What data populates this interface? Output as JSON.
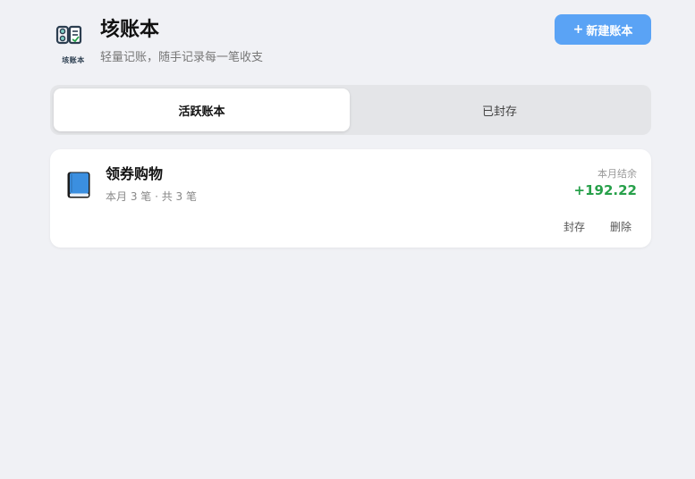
{
  "header": {
    "logo_text": "垓账本",
    "title": "垓账本",
    "subtitle": "轻量记账，随手记录每一笔收支",
    "new_button_label": "新建账本"
  },
  "tabs": [
    {
      "label": "活跃账本",
      "active": true
    },
    {
      "label": "已封存",
      "active": false
    }
  ],
  "ledgers": [
    {
      "name": "领券购物",
      "meta": "本月 3 笔 · 共 3 笔",
      "balance_label": "本月结余",
      "balance": "+192.22",
      "actions": {
        "archive": "封存",
        "delete": "删除"
      }
    }
  ],
  "colors": {
    "accent": "#5aa3f5",
    "positive": "#27a04a",
    "background": "#f0f1f5"
  },
  "icons": {
    "logo": "ledger-logo-icon",
    "book": "book-icon",
    "plus": "plus-icon"
  }
}
